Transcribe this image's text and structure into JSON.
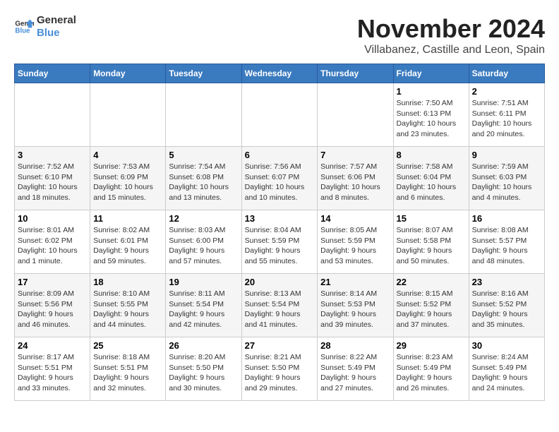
{
  "header": {
    "logo_general": "General",
    "logo_blue": "Blue",
    "month": "November 2024",
    "location": "Villabanez, Castille and Leon, Spain"
  },
  "days_of_week": [
    "Sunday",
    "Monday",
    "Tuesday",
    "Wednesday",
    "Thursday",
    "Friday",
    "Saturday"
  ],
  "weeks": [
    [
      {
        "day": "",
        "info": ""
      },
      {
        "day": "",
        "info": ""
      },
      {
        "day": "",
        "info": ""
      },
      {
        "day": "",
        "info": ""
      },
      {
        "day": "",
        "info": ""
      },
      {
        "day": "1",
        "info": "Sunrise: 7:50 AM\nSunset: 6:13 PM\nDaylight: 10 hours and 23 minutes."
      },
      {
        "day": "2",
        "info": "Sunrise: 7:51 AM\nSunset: 6:11 PM\nDaylight: 10 hours and 20 minutes."
      }
    ],
    [
      {
        "day": "3",
        "info": "Sunrise: 7:52 AM\nSunset: 6:10 PM\nDaylight: 10 hours and 18 minutes."
      },
      {
        "day": "4",
        "info": "Sunrise: 7:53 AM\nSunset: 6:09 PM\nDaylight: 10 hours and 15 minutes."
      },
      {
        "day": "5",
        "info": "Sunrise: 7:54 AM\nSunset: 6:08 PM\nDaylight: 10 hours and 13 minutes."
      },
      {
        "day": "6",
        "info": "Sunrise: 7:56 AM\nSunset: 6:07 PM\nDaylight: 10 hours and 10 minutes."
      },
      {
        "day": "7",
        "info": "Sunrise: 7:57 AM\nSunset: 6:06 PM\nDaylight: 10 hours and 8 minutes."
      },
      {
        "day": "8",
        "info": "Sunrise: 7:58 AM\nSunset: 6:04 PM\nDaylight: 10 hours and 6 minutes."
      },
      {
        "day": "9",
        "info": "Sunrise: 7:59 AM\nSunset: 6:03 PM\nDaylight: 10 hours and 4 minutes."
      }
    ],
    [
      {
        "day": "10",
        "info": "Sunrise: 8:01 AM\nSunset: 6:02 PM\nDaylight: 10 hours and 1 minute."
      },
      {
        "day": "11",
        "info": "Sunrise: 8:02 AM\nSunset: 6:01 PM\nDaylight: 9 hours and 59 minutes."
      },
      {
        "day": "12",
        "info": "Sunrise: 8:03 AM\nSunset: 6:00 PM\nDaylight: 9 hours and 57 minutes."
      },
      {
        "day": "13",
        "info": "Sunrise: 8:04 AM\nSunset: 5:59 PM\nDaylight: 9 hours and 55 minutes."
      },
      {
        "day": "14",
        "info": "Sunrise: 8:05 AM\nSunset: 5:59 PM\nDaylight: 9 hours and 53 minutes."
      },
      {
        "day": "15",
        "info": "Sunrise: 8:07 AM\nSunset: 5:58 PM\nDaylight: 9 hours and 50 minutes."
      },
      {
        "day": "16",
        "info": "Sunrise: 8:08 AM\nSunset: 5:57 PM\nDaylight: 9 hours and 48 minutes."
      }
    ],
    [
      {
        "day": "17",
        "info": "Sunrise: 8:09 AM\nSunset: 5:56 PM\nDaylight: 9 hours and 46 minutes."
      },
      {
        "day": "18",
        "info": "Sunrise: 8:10 AM\nSunset: 5:55 PM\nDaylight: 9 hours and 44 minutes."
      },
      {
        "day": "19",
        "info": "Sunrise: 8:11 AM\nSunset: 5:54 PM\nDaylight: 9 hours and 42 minutes."
      },
      {
        "day": "20",
        "info": "Sunrise: 8:13 AM\nSunset: 5:54 PM\nDaylight: 9 hours and 41 minutes."
      },
      {
        "day": "21",
        "info": "Sunrise: 8:14 AM\nSunset: 5:53 PM\nDaylight: 9 hours and 39 minutes."
      },
      {
        "day": "22",
        "info": "Sunrise: 8:15 AM\nSunset: 5:52 PM\nDaylight: 9 hours and 37 minutes."
      },
      {
        "day": "23",
        "info": "Sunrise: 8:16 AM\nSunset: 5:52 PM\nDaylight: 9 hours and 35 minutes."
      }
    ],
    [
      {
        "day": "24",
        "info": "Sunrise: 8:17 AM\nSunset: 5:51 PM\nDaylight: 9 hours and 33 minutes."
      },
      {
        "day": "25",
        "info": "Sunrise: 8:18 AM\nSunset: 5:51 PM\nDaylight: 9 hours and 32 minutes."
      },
      {
        "day": "26",
        "info": "Sunrise: 8:20 AM\nSunset: 5:50 PM\nDaylight: 9 hours and 30 minutes."
      },
      {
        "day": "27",
        "info": "Sunrise: 8:21 AM\nSunset: 5:50 PM\nDaylight: 9 hours and 29 minutes."
      },
      {
        "day": "28",
        "info": "Sunrise: 8:22 AM\nSunset: 5:49 PM\nDaylight: 9 hours and 27 minutes."
      },
      {
        "day": "29",
        "info": "Sunrise: 8:23 AM\nSunset: 5:49 PM\nDaylight: 9 hours and 26 minutes."
      },
      {
        "day": "30",
        "info": "Sunrise: 8:24 AM\nSunset: 5:49 PM\nDaylight: 9 hours and 24 minutes."
      }
    ]
  ]
}
